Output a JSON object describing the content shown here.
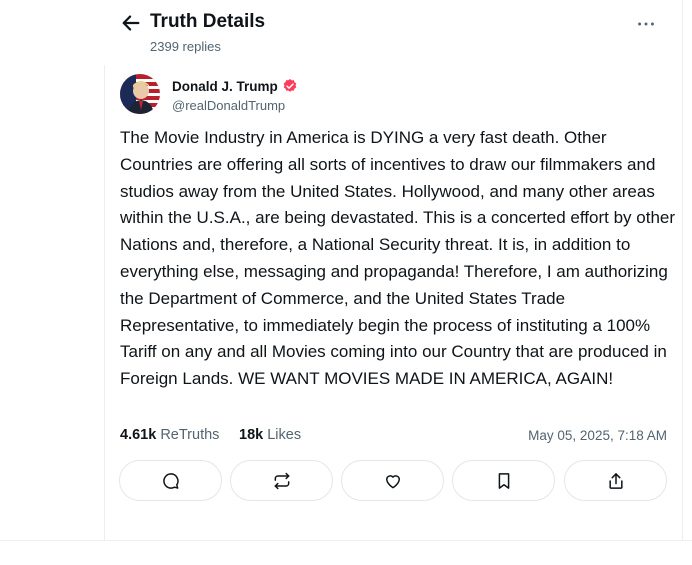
{
  "header": {
    "title": "Truth Details",
    "replies": "2399 replies"
  },
  "author": {
    "display_name": "Donald J. Trump",
    "handle": "@realDonaldTrump",
    "verified_badge_color": "#ff3b5c"
  },
  "post": {
    "text": "The Movie Industry in America is DYING a very fast death. Other Countries are offering all sorts of incentives to draw our filmmakers and studios away from the United States. Hollywood, and many other areas within the U.S.A., are being devastated. This is a concerted effort by other Nations and, therefore, a National Security threat. It is, in addition to everything else, messaging and propaganda! Therefore, I am authorizing the Department of Commerce, and the United States Trade Representative, to immediately begin the process of instituting a 100% Tariff on any and all Movies coming into our Country that are produced in Foreign Lands. WE WANT MOVIES MADE IN AMERICA, AGAIN!"
  },
  "stats": {
    "retruths_count": "4.61k",
    "retruths_label": "ReTruths",
    "likes_count": "18k",
    "likes_label": "Likes",
    "timestamp": "May 05, 2025, 7:18 AM"
  },
  "actions": [
    {
      "icon": "reply-icon"
    },
    {
      "icon": "retruth-icon"
    },
    {
      "icon": "like-icon"
    },
    {
      "icon": "bookmark-icon"
    },
    {
      "icon": "share-icon"
    }
  ],
  "colors": {
    "text": "#0f1419",
    "muted": "#536471",
    "border": "#e4e6ea"
  }
}
